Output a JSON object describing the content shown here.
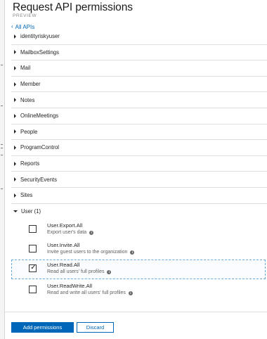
{
  "header": {
    "title": "Request API permissions",
    "subtitle": "PREVIEW",
    "back_label": "All APIs"
  },
  "groups": [
    {
      "label": "identityriskyuser"
    },
    {
      "label": "MailboxSettings"
    },
    {
      "label": "Mail"
    },
    {
      "label": "Member"
    },
    {
      "label": "Notes"
    },
    {
      "label": "OnlineMeetings"
    },
    {
      "label": "People"
    },
    {
      "label": "ProgramControl"
    },
    {
      "label": "Reports"
    },
    {
      "label": "SecurityEvents"
    },
    {
      "label": "Sites"
    },
    {
      "label": "User (1)"
    }
  ],
  "user_permissions": [
    {
      "name": "User.Export.All",
      "description": "Export user's data",
      "checked": false
    },
    {
      "name": "User.Invite.All",
      "description": "Invite guest users to the organization",
      "checked": false
    },
    {
      "name": "User.Read.All",
      "description": "Read all users' full profiles",
      "checked": true
    },
    {
      "name": "User.ReadWrite.All",
      "description": "Read and write all users' full profiles",
      "checked": false
    }
  ],
  "footer": {
    "add_label": "Add permissions",
    "discard_label": "Discard"
  },
  "colors": {
    "accent": "#0067b8",
    "selection_border": "#6aa9d8"
  },
  "icons": {
    "back": "chevron-left-icon",
    "expand": "triangle-right-icon",
    "collapse": "triangle-down-icon",
    "info": "info-icon",
    "checkmark": "checkmark-icon"
  }
}
